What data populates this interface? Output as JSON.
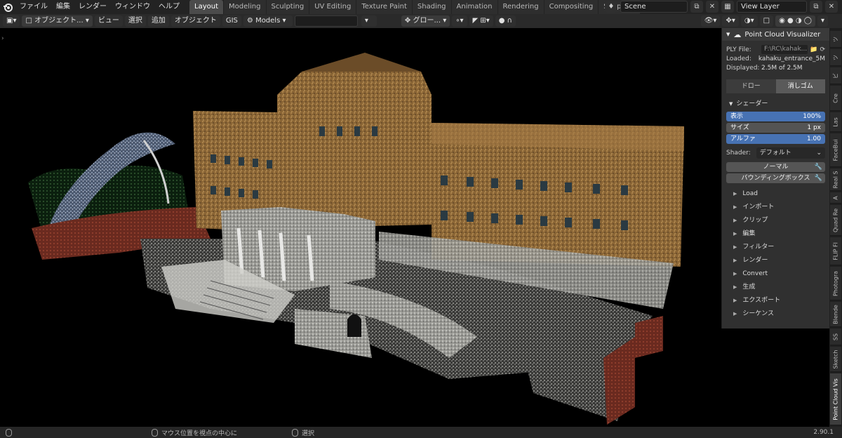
{
  "menubar": {
    "items": [
      "ファイル",
      "編集",
      "レンダー",
      "ウィンドウ",
      "ヘルプ"
    ]
  },
  "workspaces": [
    "Layout",
    "Modeling",
    "Sculpting",
    "UV Editing",
    "Texture Paint",
    "Shading",
    "Animation",
    "Rendering",
    "Compositing",
    "Scripting"
  ],
  "workspace_active": "Layout",
  "scene": {
    "name": "Scene",
    "view_layer": "View Layer"
  },
  "viewport_header": {
    "mode": "オブジェクト...",
    "menus": [
      "ビュー",
      "選択",
      "追加",
      "オブジェクト",
      "GIS"
    ],
    "collection": "Models",
    "transform_orientation": "グロー..."
  },
  "panel": {
    "title": "Point Cloud Visualizer",
    "ply_label": "PLY File:",
    "ply_value": "F:\\RC\\kahak...",
    "loaded_label": "Loaded:",
    "loaded_value": "kahaku_entrance_5M...",
    "displayed_label": "Displayed:",
    "displayed_value": "2.5M of 2.5M",
    "draw_button": "ドロー",
    "erase_button": "消しゴム",
    "shader_section": "シェーダー",
    "display_label": "表示",
    "display_value": "100%",
    "display_fraction": 1.0,
    "size_label": "サイズ",
    "size_value": "1 px",
    "alpha_label": "アルファ",
    "alpha_value": "1.00",
    "shader_label": "Shader:",
    "shader_value": "デフォルト",
    "normal_button": "ノーマル",
    "bbox_button": "バウンディングボックス",
    "sections": [
      "Load",
      "インポート",
      "クリップ",
      "編集",
      "フィルター",
      "レンダー",
      "Convert",
      "生成",
      "エクスポート",
      "シーケンス"
    ]
  },
  "vertical_tabs": [
    "ツ",
    "ツ",
    "ビ",
    "Cre",
    "Las",
    "FaceBui",
    "Real S",
    "A",
    "Quad Re",
    "FLIP Fl",
    "Photogra",
    "Blende",
    "SS",
    "Sketch",
    "Point Cloud Vis"
  ],
  "status": {
    "left_hint": "マウス位置を視点の中心に",
    "right_hint": "選択",
    "version": "2.90.1"
  },
  "colors": {
    "accent_blue": "#4772b3",
    "active_tab": "#4b4b4b"
  }
}
